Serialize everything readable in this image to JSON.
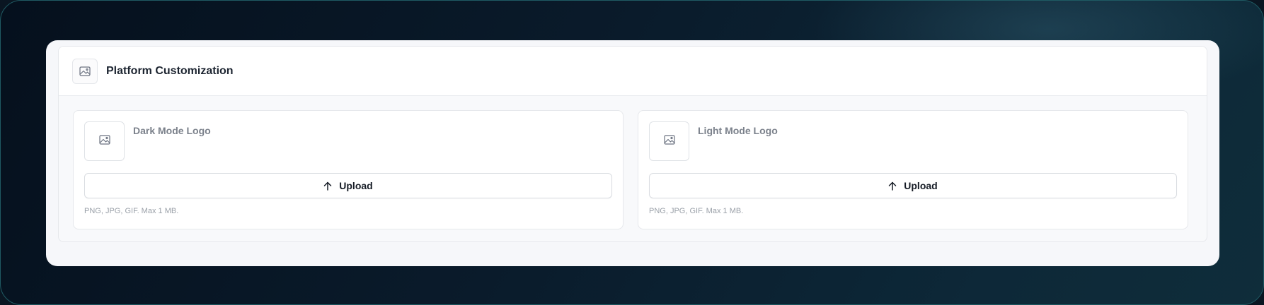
{
  "section": {
    "title": "Platform Customization",
    "icon": "image-icon"
  },
  "logos": [
    {
      "label": "Dark Mode Logo",
      "preview_icon": "image-icon",
      "upload_label": "Upload",
      "upload_icon": "arrow-up-icon",
      "hint": "PNG, JPG, GIF. Max 1 MB."
    },
    {
      "label": "Light Mode Logo",
      "preview_icon": "image-icon",
      "upload_label": "Upload",
      "upload_icon": "arrow-up-icon",
      "hint": "PNG, JPG, GIF. Max 1 MB."
    }
  ],
  "colors": {
    "background": "#0a1622",
    "card": "#f6f7fa",
    "title_text": "#1c2430",
    "muted_text": "#7b818b",
    "hint_text": "#9aa0a8"
  }
}
